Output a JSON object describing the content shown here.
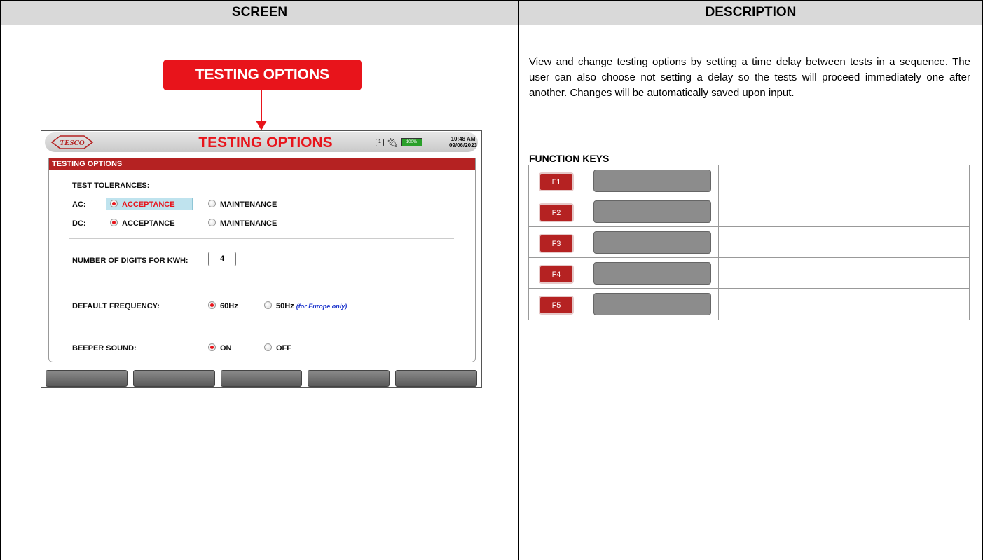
{
  "headers": {
    "screen": "SCREEN",
    "description": "DESCRIPTION"
  },
  "callout": {
    "label": "TESTING OPTIONS"
  },
  "device": {
    "title": "TESTING OPTIONS",
    "logo_text": "TESCO",
    "status": {
      "usb": "1",
      "battery": "100%",
      "time": "10:48 AM",
      "date": "09/06/2023"
    },
    "panel_title": "TESTING OPTIONS",
    "tolerances": {
      "heading": "TEST TOLERANCES:",
      "ac_label": "AC:",
      "dc_label": "DC:",
      "acceptance": "ACCEPTANCE",
      "maintenance": "MAINTENANCE",
      "ac_selected": "ACCEPTANCE",
      "dc_selected": "ACCEPTANCE"
    },
    "digits": {
      "label": "NUMBER OF DIGITS FOR KWH:",
      "value": "4"
    },
    "frequency": {
      "label": "DEFAULT FREQUENCY:",
      "opt1": "60Hz",
      "opt2": "50Hz",
      "note": "(for Europe only)",
      "selected": "60Hz"
    },
    "beeper": {
      "label": "BEEPER SOUND:",
      "opt1": "ON",
      "opt2": "OFF",
      "selected": "ON"
    }
  },
  "description": {
    "text": "View and change testing options by setting a time delay between tests in a sequence. The user can also choose not setting a delay so the tests will proceed immediately one after another. Changes will be automatically saved upon input.",
    "function_keys_title": "FUNCTION KEYS",
    "keys": [
      "F1",
      "F2",
      "F3",
      "F4",
      "F5"
    ]
  },
  "colors": {
    "accent_red": "#e8141b",
    "panel_red": "#b52222",
    "header_gray": "#d9d9d9",
    "selection_blue": "#bfe3ee"
  }
}
